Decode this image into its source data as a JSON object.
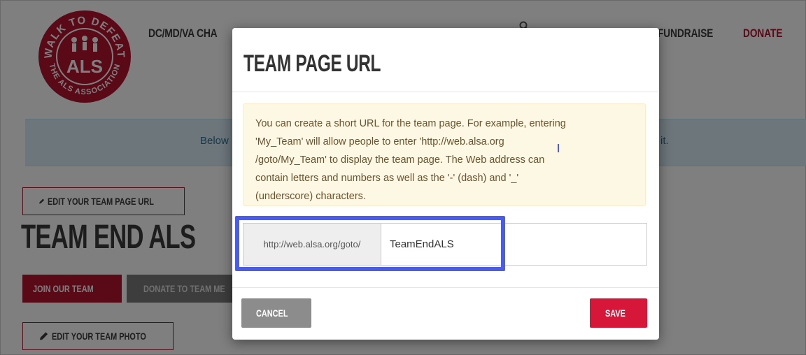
{
  "header": {
    "logo_text": {
      "top": "WALK TO DEFEAT",
      "center": "ALS",
      "bottom": "THE ALS ASSOCIATION"
    },
    "chapter": "DC/MD/VA CHA",
    "nav_fundraise": "FUNDRAISE",
    "nav_donate": "DONATE"
  },
  "info_bar": {
    "text_start": "Below",
    "text_end": "it."
  },
  "page": {
    "edit_url_label": "EDIT YOUR TEAM PAGE URL",
    "team_name": "TEAM END ALS",
    "join_label": "JOIN OUR TEAM",
    "donate_label": "DONATE TO TEAM ME",
    "edit_photo_label": "EDIT YOUR TEAM PHOTO"
  },
  "modal": {
    "title": "TEAM PAGE URL",
    "help_lines": [
      "You can create a short URL for the team page. For example, entering",
      "'My_Team' will allow people to enter 'http://web.alsa.org",
      "/goto/My_Team' to display the team page. The Web address can",
      "contain letters and numbers as well as the '-' (dash) and '_'",
      "(underscore) characters."
    ],
    "url_prefix": "http://web.alsa.org/goto/",
    "url_value": "TeamEndALS",
    "cancel_label": "CANCEL",
    "save_label": "SAVE"
  },
  "colors": {
    "brand_red": "#b5122e",
    "save_red": "#d6173a",
    "highlight_blue": "#4a5ce8",
    "help_bg": "#fcf8e3"
  }
}
